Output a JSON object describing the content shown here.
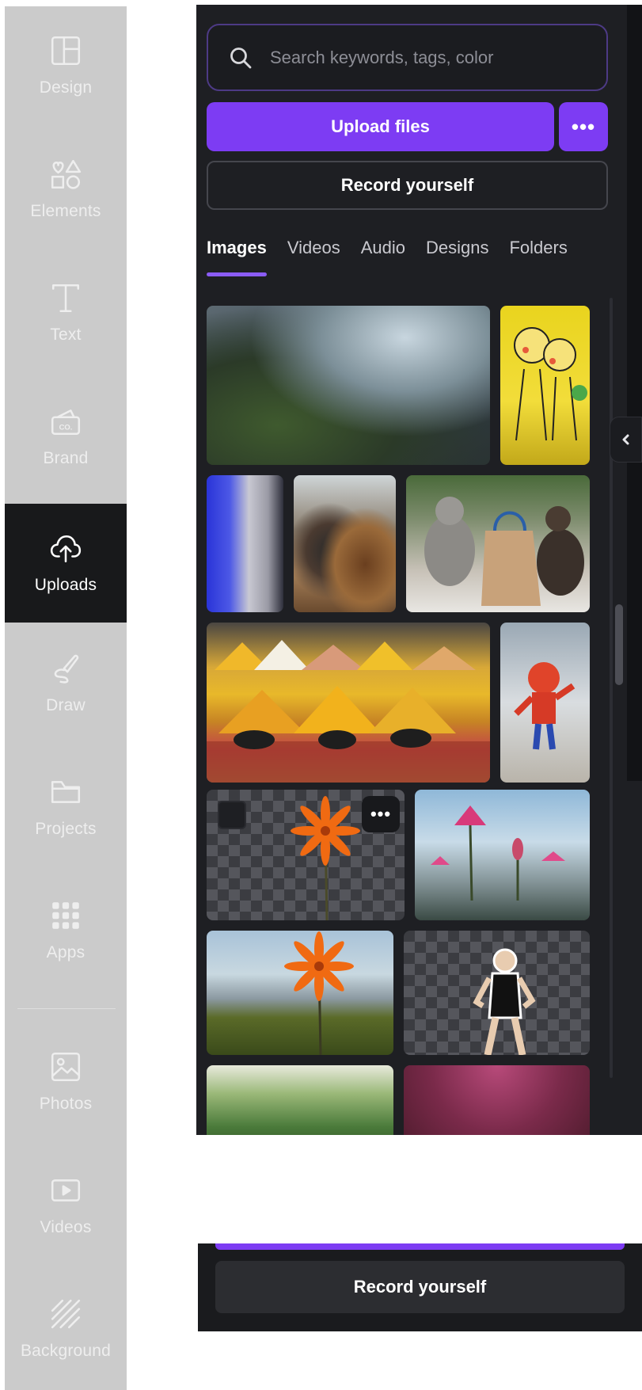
{
  "sidebar": {
    "items": [
      {
        "label": "Design",
        "icon": "layout-icon"
      },
      {
        "label": "Elements",
        "icon": "shapes-icon"
      },
      {
        "label": "Text",
        "icon": "text-icon"
      },
      {
        "label": "Brand",
        "icon": "brand-icon"
      },
      {
        "label": "Uploads",
        "icon": "cloud-upload-icon",
        "active": true
      },
      {
        "label": "Draw",
        "icon": "pen-icon"
      },
      {
        "label": "Projects",
        "icon": "folder-icon"
      },
      {
        "label": "Apps",
        "icon": "grid-icon"
      },
      {
        "label": "Photos",
        "icon": "image-icon"
      },
      {
        "label": "Videos",
        "icon": "video-icon"
      },
      {
        "label": "Background",
        "icon": "stripes-icon"
      }
    ]
  },
  "search": {
    "placeholder": "Search keywords, tags, color"
  },
  "actions": {
    "upload_label": "Upload files",
    "more_label": "•••",
    "record_label": "Record yourself"
  },
  "tabs": [
    {
      "label": "Images",
      "active": true
    },
    {
      "label": "Videos"
    },
    {
      "label": "Audio"
    },
    {
      "label": "Designs"
    },
    {
      "label": "Folders"
    }
  ],
  "gallery": {
    "images": [
      "glitter-ground-photo",
      "yellow-cartoon-poster-photo",
      "statue-blue-light-photo",
      "burger-plate-photo",
      "ceramic-figures-bag-photo",
      "spice-market-photo",
      "toy-figure-photo",
      "orange-flower-cutout",
      "pink-water-lilies-photo",
      "orange-flower-landscape-photo",
      "woman-runner-cutout",
      "green-trees-photo",
      "pink-texture-photo"
    ],
    "item_more_label": "•••"
  },
  "lower": {
    "record_label": "Record yourself"
  },
  "colors": {
    "accent": "#7d3cf3",
    "panel": "#1e1f23",
    "sidebar": "#cbcbcb"
  }
}
